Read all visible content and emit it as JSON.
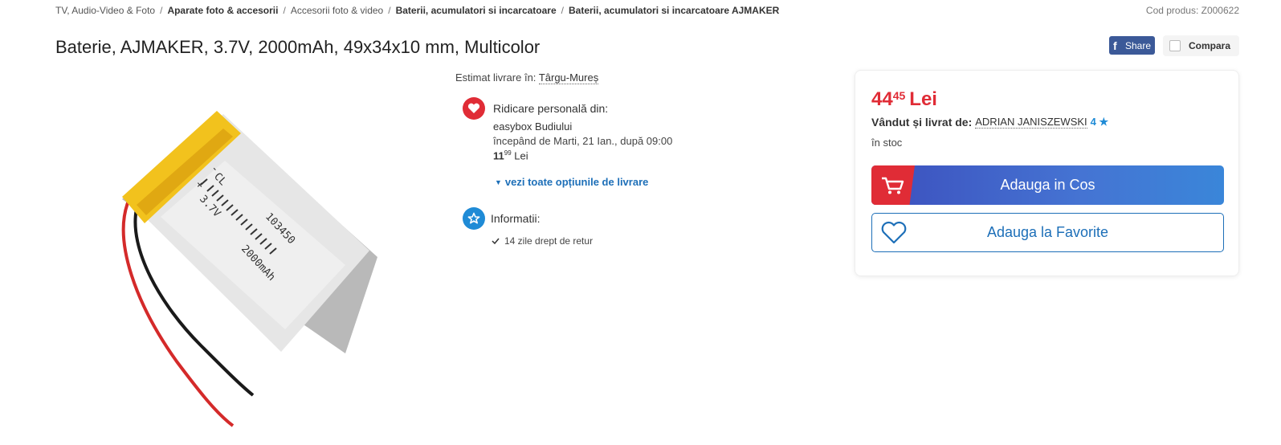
{
  "breadcrumb": {
    "items": [
      {
        "label": "TV, Audio-Video & Foto",
        "bold": false
      },
      {
        "label": "Aparate foto & accesorii",
        "bold": true
      },
      {
        "label": "Accesorii foto & video",
        "bold": false
      },
      {
        "label": "Baterii, acumulatori si incarcatoare",
        "bold": true
      },
      {
        "label": "Baterii, acumulatori si incarcatoare AJMAKER",
        "bold": true
      }
    ],
    "separator": "/"
  },
  "product_code": "Cod produs: Z000622",
  "title": "Baterie, AJMAKER, 3.7V, 2000mAh, 49x34x10 mm, Multicolor",
  "share": {
    "label": "Share",
    "icon": "facebook-icon"
  },
  "compare": {
    "label": "Compara"
  },
  "image": {
    "battery_text_1": "103450",
    "battery_text_2": "2000mAh",
    "battery_text_3": "3.7V",
    "battery_text_4": "CL",
    "battery_text_5": "+",
    "battery_text_6": "-"
  },
  "delivery": {
    "estimate_label": "Estimat livrare în:",
    "city": "Târgu-Mureș",
    "pickup_title": "Ridicare personală din:",
    "pickup_location": "easybox Budiului",
    "pickup_time": "începând de Marti, 21 Ian., după 09:00",
    "pickup_price_int": "11",
    "pickup_price_dec": "99",
    "pickup_currency": "Lei",
    "all_options": "vezi toate opțiunile de livrare",
    "info_title": "Informatii:",
    "return_policy": "14 zile drept de retur"
  },
  "buy": {
    "price_int": "44",
    "price_dec": "45",
    "currency": "Lei",
    "seller_label": "Vândut și livrat de:",
    "seller_name": "ADRIAN JANISZEWSKI",
    "seller_rating": "4",
    "stock": "în stoc",
    "add_to_cart": "Adauga in Cos",
    "add_to_favorites": "Adauga la Favorite"
  },
  "colors": {
    "accent_red": "#e02c36",
    "link_blue": "#1d6fb8",
    "cart_blue": "#4574d3",
    "facebook": "#3b5998"
  }
}
